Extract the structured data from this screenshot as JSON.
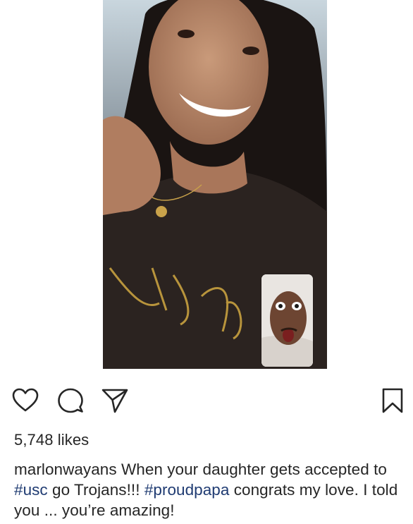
{
  "post": {
    "media_description_icon": "video-call-screenshot",
    "actions": {
      "like_icon": "heart-icon",
      "comment_icon": "comment-bubble-icon",
      "share_icon": "paper-plane-icon",
      "save_icon": "bookmark-icon"
    },
    "likes_text": "5,748 likes",
    "caption": {
      "username": "marlonwayans",
      "text_1": " When your daughter gets accepted to ",
      "hashtag_1": "#usc",
      "text_2": " go Trojans!!! ",
      "hashtag_2": "#proudpapa",
      "text_3": " congrats my love. I told you ... you’re amazing!"
    }
  },
  "colors": {
    "text": "#262626",
    "hashtag": "#1f3b72",
    "background": "#ffffff"
  }
}
